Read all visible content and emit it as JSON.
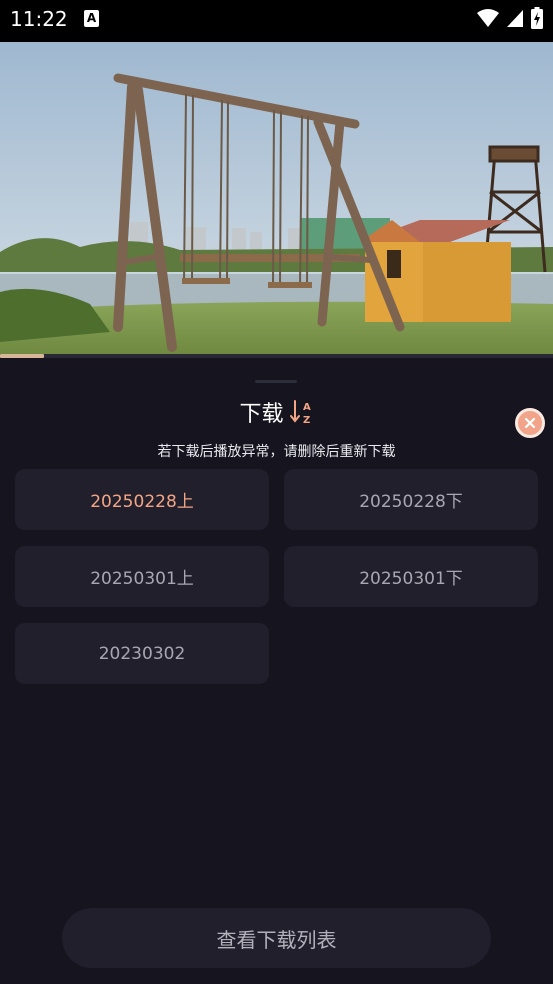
{
  "status_bar": {
    "time": "11:22",
    "notification_icon": "A",
    "icons": [
      "wifi-icon",
      "signal-icon",
      "battery-charging-icon"
    ]
  },
  "video": {
    "scene": "wooden-swing-set-by-lake",
    "progress_fraction": 0.08
  },
  "sheet": {
    "title": "下载",
    "sort_icon_letters": "AZ",
    "subtitle": "若下载后播放异常，请删除后重新下载",
    "episodes": [
      {
        "label": "20250228上",
        "selected": true
      },
      {
        "label": "20250228下",
        "selected": false
      },
      {
        "label": "20250301上",
        "selected": false
      },
      {
        "label": "20250301下",
        "selected": false
      },
      {
        "label": "20230302",
        "selected": false
      }
    ],
    "list_button": "查看下载列表"
  },
  "colors": {
    "accent": "#f3a585",
    "background": "#15141f",
    "card": "#211f2c"
  }
}
